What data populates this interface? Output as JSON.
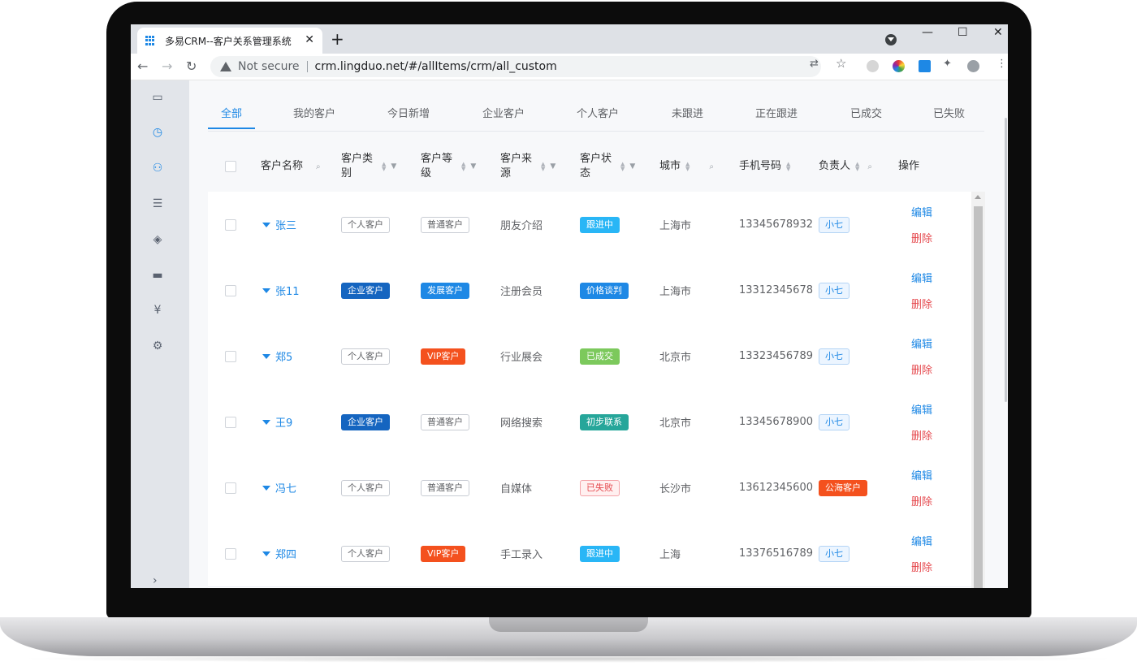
{
  "browser": {
    "tab_title": "多易CRM--客户关系管理系统",
    "tab_close": "✕",
    "new_tab": "+",
    "not_secure": "Not secure",
    "url": "crm.lingduo.net/#/allItems/crm/all_custom",
    "window_controls": {
      "minimize": "—",
      "maximize": "☐",
      "close": "✕"
    }
  },
  "filter_tabs": [
    {
      "label": "全部",
      "active": true
    },
    {
      "label": "我的客户"
    },
    {
      "label": "今日新增"
    },
    {
      "label": "企业客户"
    },
    {
      "label": "个人客户"
    },
    {
      "label": "未跟进"
    },
    {
      "label": "正在跟进"
    },
    {
      "label": "已成交"
    },
    {
      "label": "已失败"
    }
  ],
  "columns": {
    "name": "客户名称",
    "type": "客户类别",
    "level": "客户等级",
    "source": "客户来源",
    "status": "客户状态",
    "city": "城市",
    "phone": "手机号码",
    "owner": "负责人",
    "ops": "操作"
  },
  "rows": [
    {
      "name": "张三",
      "type": "个人客户",
      "level": "普通客户",
      "source": "朋友介绍",
      "status": "跟进中",
      "city": "上海市",
      "phone": "13345678932",
      "owner": "小七"
    },
    {
      "name": "张11",
      "type": "企业客户",
      "level": "发展客户",
      "source": "注册会员",
      "status": "价格谈判",
      "city": "上海市",
      "phone": "13312345678",
      "owner": "小七"
    },
    {
      "name": "郑5",
      "type": "个人客户",
      "level": "VIP客户",
      "source": "行业展会",
      "status": "已成交",
      "city": "北京市",
      "phone": "13323456789",
      "owner": "小七"
    },
    {
      "name": "王9",
      "type": "企业客户",
      "level": "普通客户",
      "source": "网络搜索",
      "status": "初步联系",
      "city": "北京市",
      "phone": "13345678900",
      "owner": "小七"
    },
    {
      "name": "冯七",
      "type": "个人客户",
      "level": "普通客户",
      "source": "自媒体",
      "status": "已失败",
      "city": "长沙市",
      "phone": "13612345600",
      "owner": "公海客户"
    },
    {
      "name": "郑四",
      "type": "个人客户",
      "level": "VIP客户",
      "source": "手工录入",
      "status": "跟进中",
      "city": "上海",
      "phone": "13376516789",
      "owner": "小七"
    }
  ],
  "actions": {
    "edit": "编辑",
    "delete": "删除"
  },
  "colors": {
    "primary": "#1e88e5",
    "enterprise": "#1565c0",
    "develop": "#1e88e5",
    "vip": "#f4511e",
    "following": "#29b6f6",
    "negotiating": "#1e88e5",
    "won": "#7cc95c",
    "contacted": "#26a69a",
    "public_pool": "#f4511e",
    "danger": "#e5484d"
  }
}
